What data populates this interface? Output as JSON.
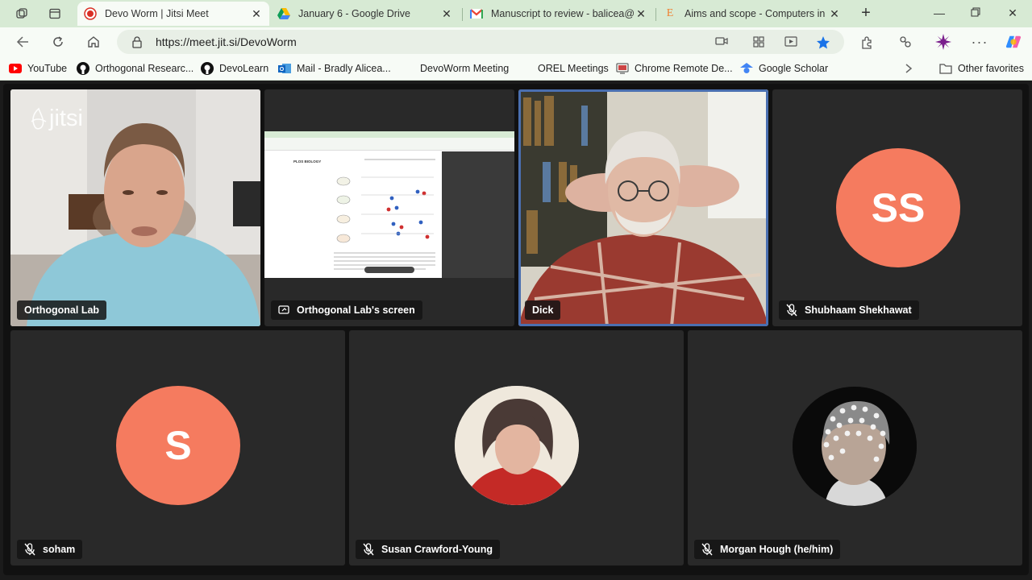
{
  "browser": {
    "tabs": [
      {
        "title": "Devo Worm | Jitsi Meet",
        "active": true,
        "icon": "record-icon"
      },
      {
        "title": "January 6 - Google Drive",
        "active": false,
        "icon": "google-drive-icon"
      },
      {
        "title": "Manuscript to review - balicea@o",
        "active": false,
        "icon": "gmail-icon"
      },
      {
        "title": "Aims and scope - Computers in B",
        "active": false,
        "icon": "elsevier-icon"
      }
    ],
    "url": "https://meet.jit.si/DevoWorm",
    "bookmarks": [
      {
        "label": "YouTube",
        "icon": "youtube-icon"
      },
      {
        "label": "Orthogonal Researc...",
        "icon": "github-icon"
      },
      {
        "label": "DevoLearn",
        "icon": "github-icon"
      },
      {
        "label": "Mail - Bradly Alicea...",
        "icon": "outlook-icon"
      },
      {
        "label": "DevoWorm Meeting",
        "icon": ""
      },
      {
        "label": "OREL Meetings",
        "icon": ""
      },
      {
        "label": "Chrome Remote De...",
        "icon": "remote-desktop-icon"
      },
      {
        "label": "Google Scholar",
        "icon": "scholar-icon"
      }
    ],
    "other_favorites": "Other favorites"
  },
  "meeting": {
    "watermark": "jitsi",
    "tiles": [
      {
        "name": "Orthogonal Lab",
        "muted": false,
        "kind": "camera"
      },
      {
        "name": "Orthogonal Lab's screen",
        "muted": false,
        "kind": "screen"
      },
      {
        "name": "Dick",
        "muted": false,
        "kind": "camera",
        "active_speaker": true
      },
      {
        "name": "Shubhaam Shekhawat",
        "muted": true,
        "kind": "avatar",
        "initials": "SS"
      },
      {
        "name": "soham",
        "muted": true,
        "kind": "avatar",
        "initials": "S"
      },
      {
        "name": "Susan Crawford-Young",
        "muted": true,
        "kind": "photo"
      },
      {
        "name": "Morgan Hough (he/him)",
        "muted": true,
        "kind": "photo"
      }
    ],
    "shared_doc_heading": "PLOS BIOLOGY",
    "colors": {
      "avatar": "#f57b5f",
      "active_border": "#4a6fb0"
    }
  }
}
